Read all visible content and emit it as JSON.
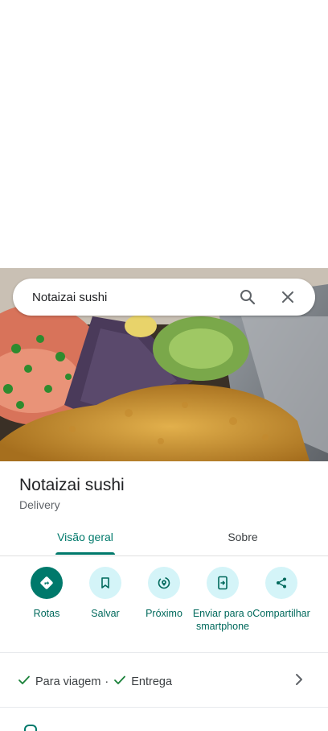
{
  "search": {
    "query": "Notaizai sushi"
  },
  "place": {
    "name": "Notaizai sushi",
    "category": "Delivery"
  },
  "tabs": [
    {
      "label": "Visão geral"
    },
    {
      "label": "Sobre"
    }
  ],
  "actions": [
    {
      "label": "Rotas",
      "icon": "directions-icon"
    },
    {
      "label": "Salvar",
      "icon": "bookmark-icon"
    },
    {
      "label": "Próximo",
      "icon": "nearby-icon"
    },
    {
      "label": "Enviar para o smartphone",
      "icon": "send-to-phone-icon"
    },
    {
      "label": "Compartilhar",
      "icon": "share-icon"
    }
  ],
  "service_options": {
    "takeaway": "Para viagem",
    "separator": "·",
    "delivery": "Entrega"
  },
  "colors": {
    "accent": "#00796b",
    "accent_light": "#d4f4f8",
    "check": "#188038"
  }
}
